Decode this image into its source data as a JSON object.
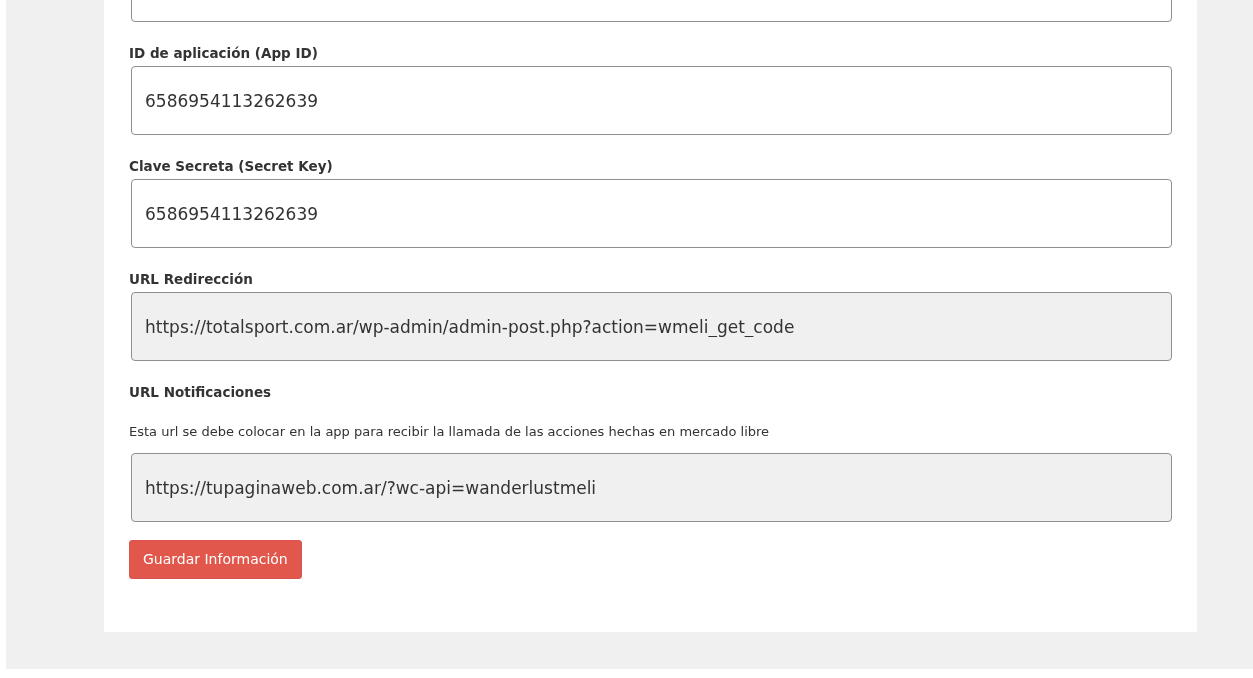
{
  "fields": [
    {
      "kind": "cut",
      "readonly": false
    },
    {
      "kind": "field",
      "label": "ID de aplicación (App ID)",
      "value": "6586954113262639",
      "readonly": false
    },
    {
      "kind": "field",
      "label": "Clave Secreta (Secret Key)",
      "value": "6586954113262639",
      "readonly": false
    },
    {
      "kind": "field",
      "label": "URL Redirección",
      "value": "https://totalsport.com.ar/wp-admin/admin-post.php?action=wmeli_get_code",
      "readonly": true
    },
    {
      "kind": "field",
      "label": "URL Notificaciones",
      "help": "Esta url se debe colocar en la app para recibir la llamada de las acciones hechas en mercado libre",
      "value": "https://tupaginaweb.com.ar/?wc-api=wanderlustmeli",
      "readonly": true
    }
  ],
  "button": {
    "label": "Guardar Información"
  }
}
